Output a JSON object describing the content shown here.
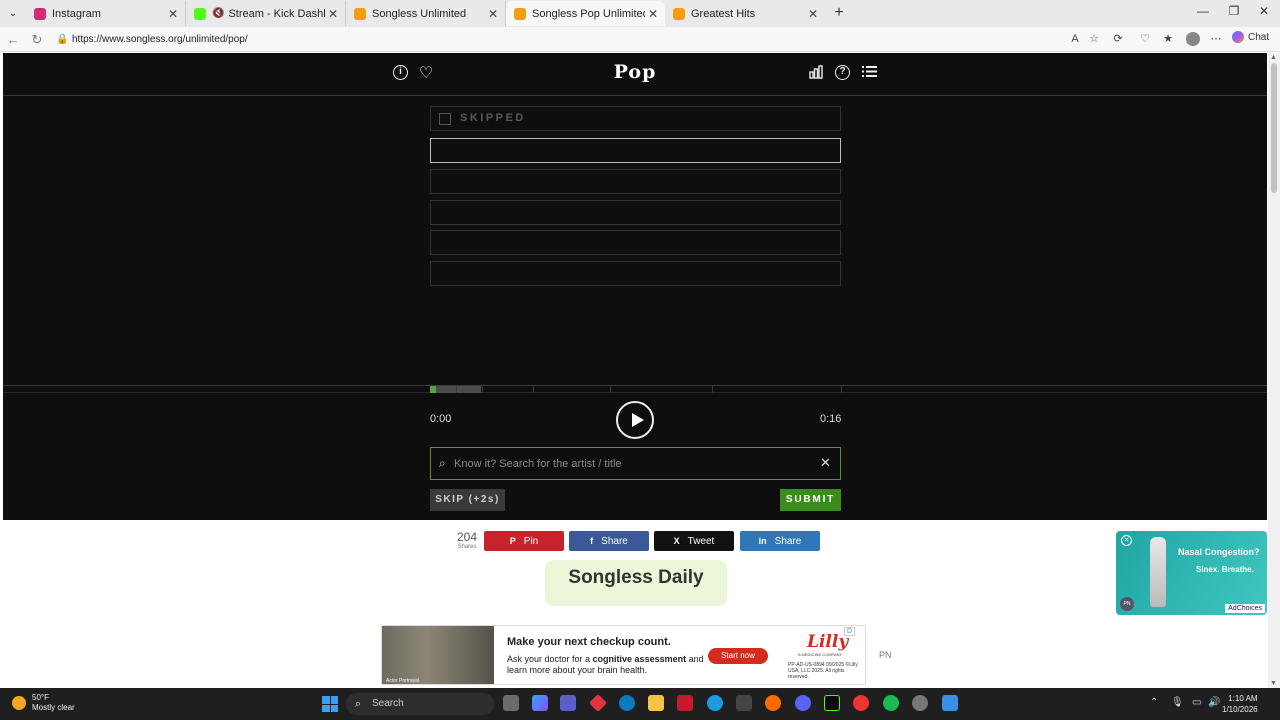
{
  "browser": {
    "tabs": [
      {
        "title": "Instagram",
        "favicon_color": "#d62976",
        "active": false
      },
      {
        "title": "Stream - Kick Dashboard",
        "favicon_color": "#53fc18",
        "active": false,
        "muted": true
      },
      {
        "title": "Songless Unlimited",
        "favicon_color": "#f59e0b",
        "active": false
      },
      {
        "title": "Songless Pop Unlimited",
        "favicon_color": "#f59e0b",
        "active": true
      },
      {
        "title": "Greatest Hits",
        "favicon_color": "#f59e0b",
        "active": false
      }
    ],
    "url": "https://www.songless.org/unlimited/pop/",
    "chat_label": "Chat"
  },
  "game": {
    "title": "Pop",
    "header_icons": [
      "info-icon",
      "heart-icon",
      "stats-icon",
      "help-icon",
      "list-icon"
    ],
    "guesses": [
      {
        "label": "SKIPPED",
        "state": "skipped"
      },
      {
        "label": "",
        "state": "current"
      },
      {
        "label": "",
        "state": "empty"
      },
      {
        "label": "",
        "state": "empty"
      },
      {
        "label": "",
        "state": "empty"
      },
      {
        "label": "",
        "state": "empty"
      }
    ],
    "progress": {
      "played_fraction": 0.015,
      "unlocked_fraction": 0.125,
      "colors": {
        "played": "#5aa33a",
        "unlocked": "#4d4d4d"
      }
    },
    "time_start": "0:00",
    "time_end": "0:16",
    "search": {
      "placeholder": "Know it? Search for the artist / title",
      "value": ""
    },
    "skip_label": "SKIP (+2s)",
    "submit_label": "SUBMIT",
    "colors": {
      "background": "#0e0e0e",
      "accent": "#3b8c1e"
    }
  },
  "share": {
    "count": "204",
    "count_label": "Shares",
    "buttons": [
      {
        "label": "Pin",
        "icon": "pinterest-icon",
        "glyph": "P",
        "color": "#c8232c"
      },
      {
        "label": "Share",
        "icon": "facebook-icon",
        "glyph": "f",
        "color": "#3b5998"
      },
      {
        "label": "Tweet",
        "icon": "x-icon",
        "glyph": "X",
        "color": "#111111"
      },
      {
        "label": "Share",
        "icon": "linkedin-icon",
        "glyph": "in",
        "color": "#2f77b8"
      }
    ]
  },
  "daily": {
    "label": "Songless Daily"
  },
  "side_ad": {
    "headline": "Nasal Congestion?",
    "body": "Sinex. Breathe.",
    "adchoices": "AdChoices",
    "pn": "PN"
  },
  "bottom_ad": {
    "caption": "Actor Portrayal",
    "headline": "Make your next checkup count.",
    "line_prefix": "Ask your doctor for a ",
    "line_bold": "cognitive assessment",
    "line_suffix": " and learn more about your brain health.",
    "cta": "Start now",
    "logo": "Lilly",
    "logo_sub": "A MEDICINE COMPANY",
    "legal": "PP-AD-US-0894 09/2025 ©Lilly USA, LLC 2025. All rights reserved.",
    "adinfo": "D",
    "pn_label": "PN"
  },
  "taskbar": {
    "temp": "50°F",
    "weather": "Mostly clear",
    "search_label": "Search",
    "time": "1:10 AM",
    "date": "1/10/2026"
  }
}
